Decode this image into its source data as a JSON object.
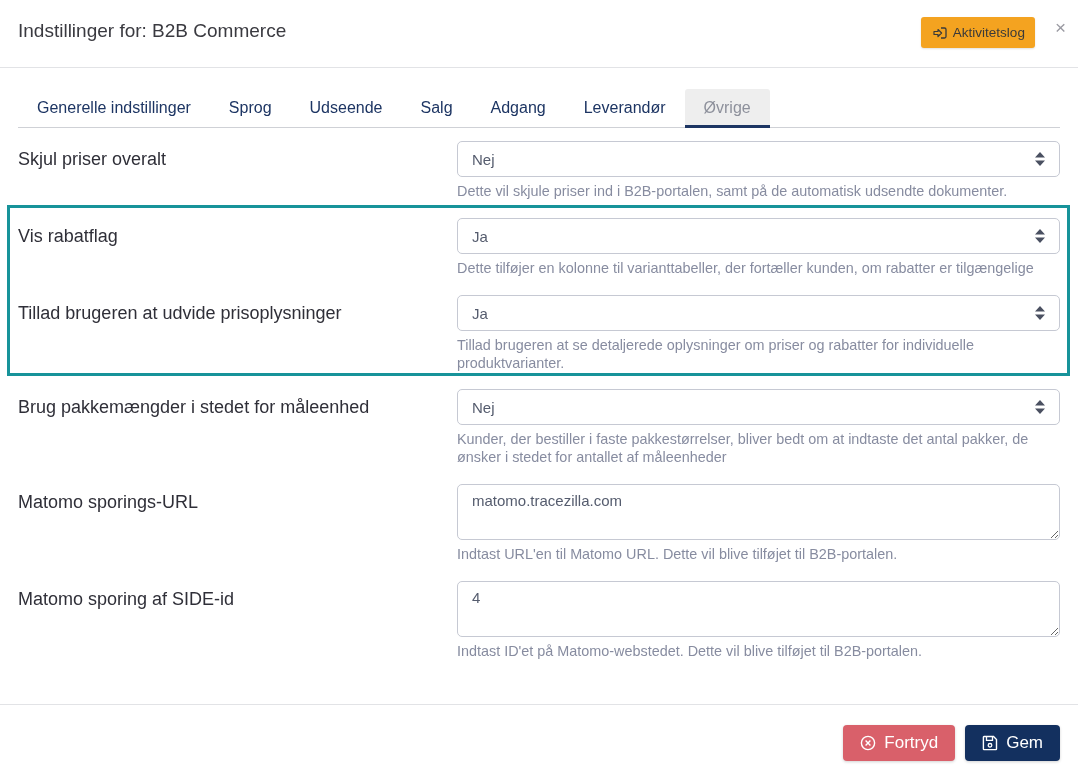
{
  "dialog": {
    "title": "Indstillinger for: B2B Commerce",
    "activity_button": {
      "label": "Aktivitetslog"
    },
    "close_label": "×"
  },
  "tabs": [
    {
      "label": "Generelle indstillinger",
      "selected": false
    },
    {
      "label": "Sprog",
      "selected": false
    },
    {
      "label": "Udseende",
      "selected": false
    },
    {
      "label": "Salg",
      "selected": false
    },
    {
      "label": "Adgang",
      "selected": false
    },
    {
      "label": "Leverandør",
      "selected": false
    },
    {
      "label": "Øvrige",
      "selected": true
    }
  ],
  "settings": [
    {
      "kind": "select",
      "label": "Skjul priser overalt",
      "value": "Nej",
      "help": "Dette vil skjule priser ind i B2B-portalen, samt på de automatisk udsendte dokumenter.",
      "highlighted": false
    },
    {
      "kind": "select",
      "label": "Vis rabatflag",
      "value": "Ja",
      "help": "Dette tilføjer en kolonne til varianttabeller, der fortæller kunden, om rabatter er tilgængelige",
      "highlighted": true
    },
    {
      "kind": "select",
      "label": "Tillad brugeren at udvide prisoplysninger",
      "value": "Ja",
      "help": "Tillad brugeren at se detaljerede oplysninger om priser og rabatter for individuelle produktvarianter.",
      "highlighted": true
    },
    {
      "kind": "select",
      "label": "Brug pakkemængder i stedet for måleenhed",
      "value": "Nej",
      "help": "Kunder, der bestiller i faste pakkestørrelser, bliver bedt om at indtaste det antal pakker, de ønsker i stedet for antallet af måleenheder",
      "highlighted": false
    },
    {
      "kind": "textarea",
      "label": "Matomo sporings-URL",
      "value": "matomo.tracezilla.com",
      "help": "Indtast URL'en til Matomo URL. Dette vil blive tilføjet til B2B-portalen.",
      "highlighted": false
    },
    {
      "kind": "textarea",
      "label": "Matomo sporing af SIDE-id",
      "value": "4",
      "help": "Indtast ID'et på Matomo-webstedet. Dette vil blive tilføjet til B2B-portalen.",
      "highlighted": false
    }
  ],
  "footer": {
    "buttons": [
      {
        "kind": "cancel",
        "label": "Fortryd"
      },
      {
        "kind": "save",
        "label": "Gem"
      }
    ]
  }
}
